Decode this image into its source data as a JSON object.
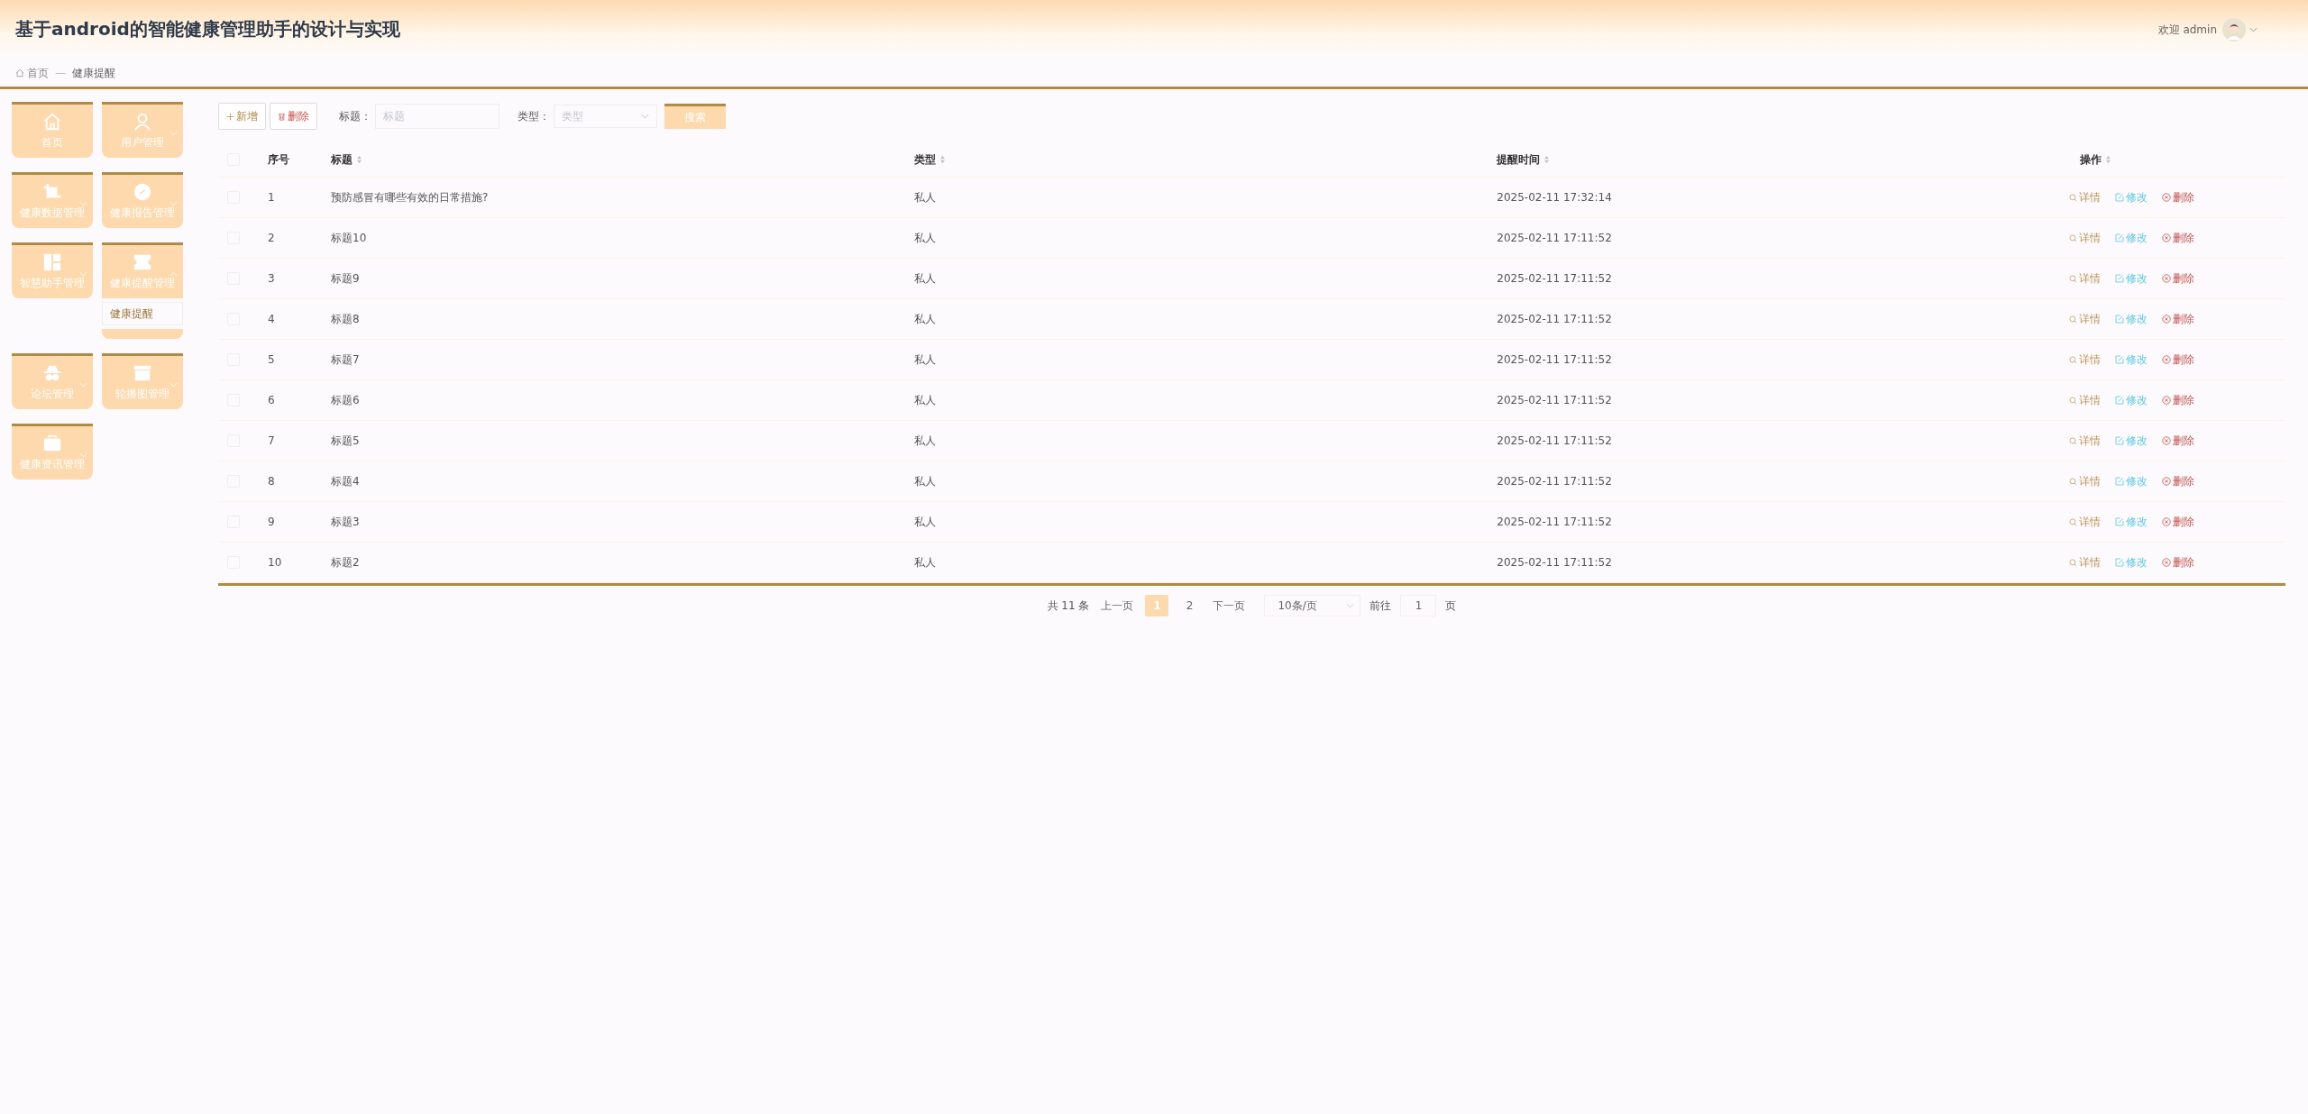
{
  "header": {
    "title": "基于android的智能健康管理助手的设计与实现",
    "greeting": "欢迎 admin"
  },
  "breadcrumb": {
    "items": [
      "首页",
      "健康提醒"
    ],
    "separator": "—"
  },
  "sidebar": {
    "items": [
      {
        "label": "首页",
        "has_submenu": false,
        "expanded": false
      },
      {
        "label": "用户管理",
        "has_submenu": true,
        "expanded": false
      },
      {
        "label": "健康数据管理",
        "has_submenu": true,
        "expanded": false
      },
      {
        "label": "健康报告管理",
        "has_submenu": true,
        "expanded": false
      },
      {
        "label": "智慧助手管理",
        "has_submenu": true,
        "expanded": false
      },
      {
        "label": "健康提醒管理",
        "has_submenu": true,
        "expanded": true,
        "children": [
          {
            "label": "健康提醒",
            "selected": true
          }
        ]
      },
      {
        "label": "论坛管理",
        "has_submenu": true,
        "expanded": false
      },
      {
        "label": "轮播图管理",
        "has_submenu": true,
        "expanded": false
      },
      {
        "label": "健康资讯管理",
        "has_submenu": true,
        "expanded": false
      }
    ]
  },
  "toolbar": {
    "add_button": "新增",
    "delete_button": "删除",
    "title_filter": {
      "label": "标题：",
      "placeholder": "标题"
    },
    "type_filter": {
      "label": "类型：",
      "placeholder": "类型"
    },
    "search_button": "搜索"
  },
  "table": {
    "select_all_checked": false,
    "columns": [
      {
        "label": "序号",
        "sortable": false
      },
      {
        "label": "标题",
        "sortable": true
      },
      {
        "label": "类型",
        "sortable": true
      },
      {
        "label": "提醒时间",
        "sortable": true
      },
      {
        "label": "操作",
        "sortable": true
      }
    ],
    "rows": [
      {
        "checked": false,
        "index": "1",
        "title": "预防感冒有哪些有效的日常措施?",
        "type": "私人",
        "time": "2025-02-11 17:32:14",
        "actions": [
          {
            "label": "详情",
            "kind": "detail"
          },
          {
            "label": "修改",
            "kind": "edit"
          },
          {
            "label": "删除",
            "kind": "delete"
          }
        ]
      },
      {
        "checked": false,
        "index": "2",
        "title": "标题10",
        "type": "私人",
        "time": "2025-02-11 17:11:52",
        "actions": [
          {
            "label": "详情",
            "kind": "detail"
          },
          {
            "label": "修改",
            "kind": "edit"
          },
          {
            "label": "删除",
            "kind": "delete"
          }
        ]
      },
      {
        "checked": false,
        "index": "3",
        "title": "标题9",
        "type": "私人",
        "time": "2025-02-11 17:11:52",
        "actions": [
          {
            "label": "详情",
            "kind": "detail"
          },
          {
            "label": "修改",
            "kind": "edit"
          },
          {
            "label": "删除",
            "kind": "delete"
          }
        ]
      },
      {
        "checked": false,
        "index": "4",
        "title": "标题8",
        "type": "私人",
        "time": "2025-02-11 17:11:52",
        "actions": [
          {
            "label": "详情",
            "kind": "detail"
          },
          {
            "label": "修改",
            "kind": "edit"
          },
          {
            "label": "删除",
            "kind": "delete"
          }
        ]
      },
      {
        "checked": false,
        "index": "5",
        "title": "标题7",
        "type": "私人",
        "time": "2025-02-11 17:11:52",
        "actions": [
          {
            "label": "详情",
            "kind": "detail"
          },
          {
            "label": "修改",
            "kind": "edit"
          },
          {
            "label": "删除",
            "kind": "delete"
          }
        ]
      },
      {
        "checked": false,
        "index": "6",
        "title": "标题6",
        "type": "私人",
        "time": "2025-02-11 17:11:52",
        "actions": [
          {
            "label": "详情",
            "kind": "detail"
          },
          {
            "label": "修改",
            "kind": "edit"
          },
          {
            "label": "删除",
            "kind": "delete"
          }
        ]
      },
      {
        "checked": false,
        "index": "7",
        "title": "标题5",
        "type": "私人",
        "time": "2025-02-11 17:11:52",
        "actions": [
          {
            "label": "详情",
            "kind": "detail"
          },
          {
            "label": "修改",
            "kind": "edit"
          },
          {
            "label": "删除",
            "kind": "delete"
          }
        ]
      },
      {
        "checked": false,
        "index": "8",
        "title": "标题4",
        "type": "私人",
        "time": "2025-02-11 17:11:52",
        "actions": [
          {
            "label": "详情",
            "kind": "detail"
          },
          {
            "label": "修改",
            "kind": "edit"
          },
          {
            "label": "删除",
            "kind": "delete"
          }
        ]
      },
      {
        "checked": false,
        "index": "9",
        "title": "标题3",
        "type": "私人",
        "time": "2025-02-11 17:11:52",
        "actions": [
          {
            "label": "详情",
            "kind": "detail"
          },
          {
            "label": "修改",
            "kind": "edit"
          },
          {
            "label": "删除",
            "kind": "delete"
          }
        ]
      },
      {
        "checked": false,
        "index": "10",
        "title": "标题2",
        "type": "私人",
        "time": "2025-02-11 17:11:52",
        "actions": [
          {
            "label": "详情",
            "kind": "detail"
          },
          {
            "label": "修改",
            "kind": "edit"
          },
          {
            "label": "删除",
            "kind": "delete"
          }
        ]
      }
    ]
  },
  "pagination": {
    "total": "共 11 条",
    "prev": "上一页",
    "pages": [
      {
        "label": "1",
        "selected": true
      },
      {
        "label": "2",
        "selected": false
      }
    ],
    "next": "下一页",
    "page_size": "10条/页",
    "goto_label": "前往",
    "goto_value": "1",
    "goto_suffix": "页"
  }
}
